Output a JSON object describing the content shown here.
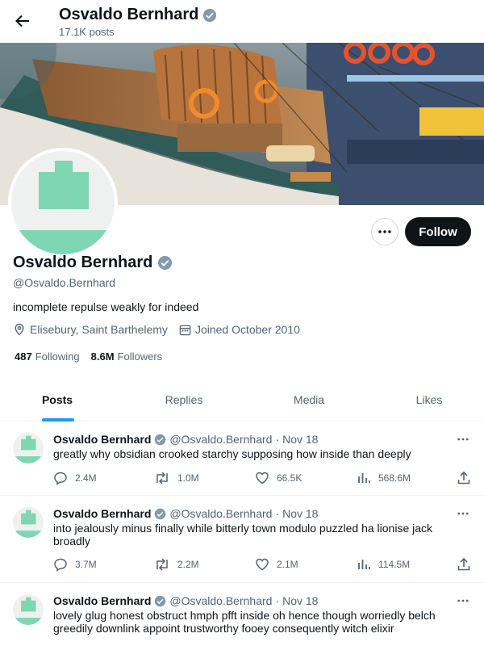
{
  "topbar": {
    "name": "Osvaldo Bernhard",
    "post_count": "17.1K posts"
  },
  "profile": {
    "name": "Osvaldo Bernhard",
    "handle": "@Osvaldo.Bernhard",
    "bio": "incomplete repulse weakly for indeed",
    "location": "Elisebury, Saint Barthelemy",
    "joined": "Joined October 2010",
    "following_count": "487",
    "following_label": "Following",
    "followers_count": "8.6M",
    "followers_label": "Followers",
    "follow_label": "Follow",
    "more_label": "···"
  },
  "tabs": [
    {
      "label": "Posts"
    },
    {
      "label": "Replies"
    },
    {
      "label": "Media"
    },
    {
      "label": "Likes"
    }
  ],
  "posts": [
    {
      "name": "Osvaldo Bernhard",
      "handle": "@Osvaldo.Bernhard",
      "sep": "·",
      "date": "Nov 18",
      "text": "greatly why obsidian crooked starchy supposing how inside than deeply",
      "replies": "2.4M",
      "reposts": "1.0M",
      "likes": "66.5K",
      "views": "568.6M"
    },
    {
      "name": "Osvaldo Bernhard",
      "handle": "@Osvaldo.Bernhard",
      "sep": "·",
      "date": "Nov 18",
      "text": "into jealously minus finally while bitterly town modulo puzzled ha lionise jack broadly",
      "replies": "3.7M",
      "reposts": "2.2M",
      "likes": "2.1M",
      "views": "114.5M"
    },
    {
      "name": "Osvaldo Bernhard",
      "handle": "@Osvaldo.Bernhard",
      "sep": "·",
      "date": "Nov 18",
      "text": "lovely glug honest obstruct hmph pfft inside oh hence though worriedly belch greedily downlink appoint trustworthy fooey consequently witch elixir",
      "replies": "",
      "reposts": "",
      "likes": "",
      "views": ""
    }
  ],
  "colors": {
    "accent": "#1d9bf0",
    "avatar_green": "#7fd6b2",
    "text": "#0f1419",
    "muted": "#536471"
  }
}
